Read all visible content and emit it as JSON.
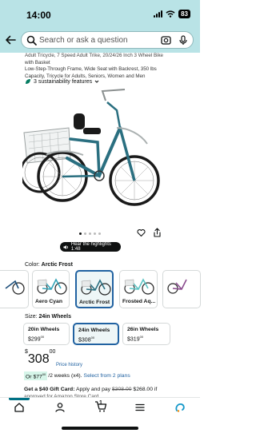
{
  "status_bar": {
    "time": "14:00",
    "battery": "83",
    "background": "#b9e3e6"
  },
  "search": {
    "placeholder": "Search or ask a question",
    "back_icon": "arrow-left-icon",
    "camera_icon": "camera-scan-icon",
    "mic_icon": "microphone-icon"
  },
  "product": {
    "title_lines": [
      "Adult Tricycle, 7 Speed Adult Trike, 20/24/26 Inch 3 Wheel Bike",
      "with Basket",
      "Low-Step-Through Frame, Wide Seat with Backrest, 350 lbs",
      "Capacity, Tricycle for Adults, Seniors, Women and Men"
    ],
    "sustainability": "3 sustainability features",
    "image_name": "teal-adult-tricycle-image",
    "frame_color": "#2a6f80",
    "image_dots": 5,
    "highlights": "Hear the highlights 1:48"
  },
  "color": {
    "label": "Color:",
    "selected": "Arctic Frost",
    "options": [
      {
        "label": "",
        "frame": "#1d4f7a"
      },
      {
        "label": "Aero Cyan",
        "frame": "#34a4b8"
      },
      {
        "label": "Arctic Frost",
        "frame": "#2a6f80"
      },
      {
        "label": "Frosted Aq...",
        "frame": "#5cc4c4"
      },
      {
        "label": "",
        "frame": "#8a4b8e"
      }
    ]
  },
  "size": {
    "label": "Size:",
    "selected": "24in Wheels",
    "options": [
      {
        "name": "20in Wheels",
        "whole": "299",
        "cents": "00"
      },
      {
        "name": "24in Wheels",
        "whole": "308",
        "cents": "00"
      },
      {
        "name": "26in Wheels",
        "whole": "319",
        "cents": "00"
      }
    ],
    "currency": "$"
  },
  "price": {
    "symbol": "$",
    "whole": "308",
    "cents": "00",
    "history_link": "Price history",
    "installment_prefix": "Or $77",
    "installment_cents": "00",
    "installment_rest": "/2 weeks (x4).",
    "installment_link": "Select from 2 plans",
    "gift_bold": "Get a $40 Gift Card:",
    "gift_text": " Apply and pay ",
    "gift_strike": "$308.00",
    "gift_final": " $268.00 if",
    "gift_line2": "approved for Amazon Store Card"
  },
  "nav": {
    "items": [
      "home-icon",
      "account-icon",
      "cart-icon",
      "menu-icon",
      "rufus-icon"
    ],
    "cart_count": "1",
    "accent": "#007185"
  }
}
